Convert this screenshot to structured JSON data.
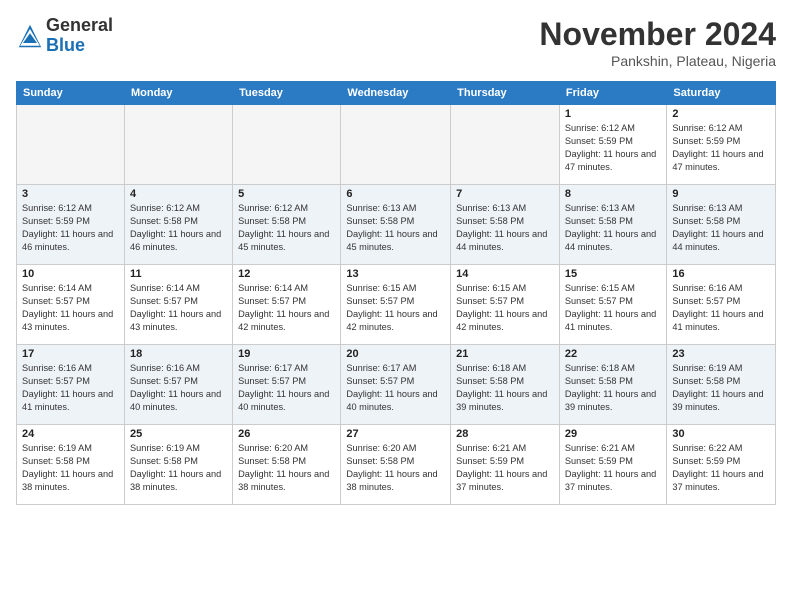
{
  "header": {
    "logo_line1": "General",
    "logo_line2": "Blue",
    "month_title": "November 2024",
    "subtitle": "Pankshin, Plateau, Nigeria"
  },
  "weekdays": [
    "Sunday",
    "Monday",
    "Tuesday",
    "Wednesday",
    "Thursday",
    "Friday",
    "Saturday"
  ],
  "weeks": [
    [
      {
        "day": "",
        "empty": true
      },
      {
        "day": "",
        "empty": true
      },
      {
        "day": "",
        "empty": true
      },
      {
        "day": "",
        "empty": true
      },
      {
        "day": "",
        "empty": true
      },
      {
        "day": "1",
        "sunrise": "6:12 AM",
        "sunset": "5:59 PM",
        "daylight": "11 hours and 47 minutes."
      },
      {
        "day": "2",
        "sunrise": "6:12 AM",
        "sunset": "5:59 PM",
        "daylight": "11 hours and 47 minutes."
      }
    ],
    [
      {
        "day": "3",
        "sunrise": "6:12 AM",
        "sunset": "5:59 PM",
        "daylight": "11 hours and 46 minutes."
      },
      {
        "day": "4",
        "sunrise": "6:12 AM",
        "sunset": "5:58 PM",
        "daylight": "11 hours and 46 minutes."
      },
      {
        "day": "5",
        "sunrise": "6:12 AM",
        "sunset": "5:58 PM",
        "daylight": "11 hours and 45 minutes."
      },
      {
        "day": "6",
        "sunrise": "6:13 AM",
        "sunset": "5:58 PM",
        "daylight": "11 hours and 45 minutes."
      },
      {
        "day": "7",
        "sunrise": "6:13 AM",
        "sunset": "5:58 PM",
        "daylight": "11 hours and 44 minutes."
      },
      {
        "day": "8",
        "sunrise": "6:13 AM",
        "sunset": "5:58 PM",
        "daylight": "11 hours and 44 minutes."
      },
      {
        "day": "9",
        "sunrise": "6:13 AM",
        "sunset": "5:58 PM",
        "daylight": "11 hours and 44 minutes."
      }
    ],
    [
      {
        "day": "10",
        "sunrise": "6:14 AM",
        "sunset": "5:57 PM",
        "daylight": "11 hours and 43 minutes."
      },
      {
        "day": "11",
        "sunrise": "6:14 AM",
        "sunset": "5:57 PM",
        "daylight": "11 hours and 43 minutes."
      },
      {
        "day": "12",
        "sunrise": "6:14 AM",
        "sunset": "5:57 PM",
        "daylight": "11 hours and 42 minutes."
      },
      {
        "day": "13",
        "sunrise": "6:15 AM",
        "sunset": "5:57 PM",
        "daylight": "11 hours and 42 minutes."
      },
      {
        "day": "14",
        "sunrise": "6:15 AM",
        "sunset": "5:57 PM",
        "daylight": "11 hours and 42 minutes."
      },
      {
        "day": "15",
        "sunrise": "6:15 AM",
        "sunset": "5:57 PM",
        "daylight": "11 hours and 41 minutes."
      },
      {
        "day": "16",
        "sunrise": "6:16 AM",
        "sunset": "5:57 PM",
        "daylight": "11 hours and 41 minutes."
      }
    ],
    [
      {
        "day": "17",
        "sunrise": "6:16 AM",
        "sunset": "5:57 PM",
        "daylight": "11 hours and 41 minutes."
      },
      {
        "day": "18",
        "sunrise": "6:16 AM",
        "sunset": "5:57 PM",
        "daylight": "11 hours and 40 minutes."
      },
      {
        "day": "19",
        "sunrise": "6:17 AM",
        "sunset": "5:57 PM",
        "daylight": "11 hours and 40 minutes."
      },
      {
        "day": "20",
        "sunrise": "6:17 AM",
        "sunset": "5:57 PM",
        "daylight": "11 hours and 40 minutes."
      },
      {
        "day": "21",
        "sunrise": "6:18 AM",
        "sunset": "5:58 PM",
        "daylight": "11 hours and 39 minutes."
      },
      {
        "day": "22",
        "sunrise": "6:18 AM",
        "sunset": "5:58 PM",
        "daylight": "11 hours and 39 minutes."
      },
      {
        "day": "23",
        "sunrise": "6:19 AM",
        "sunset": "5:58 PM",
        "daylight": "11 hours and 39 minutes."
      }
    ],
    [
      {
        "day": "24",
        "sunrise": "6:19 AM",
        "sunset": "5:58 PM",
        "daylight": "11 hours and 38 minutes."
      },
      {
        "day": "25",
        "sunrise": "6:19 AM",
        "sunset": "5:58 PM",
        "daylight": "11 hours and 38 minutes."
      },
      {
        "day": "26",
        "sunrise": "6:20 AM",
        "sunset": "5:58 PM",
        "daylight": "11 hours and 38 minutes."
      },
      {
        "day": "27",
        "sunrise": "6:20 AM",
        "sunset": "5:58 PM",
        "daylight": "11 hours and 38 minutes."
      },
      {
        "day": "28",
        "sunrise": "6:21 AM",
        "sunset": "5:59 PM",
        "daylight": "11 hours and 37 minutes."
      },
      {
        "day": "29",
        "sunrise": "6:21 AM",
        "sunset": "5:59 PM",
        "daylight": "11 hours and 37 minutes."
      },
      {
        "day": "30",
        "sunrise": "6:22 AM",
        "sunset": "5:59 PM",
        "daylight": "11 hours and 37 minutes."
      }
    ]
  ]
}
